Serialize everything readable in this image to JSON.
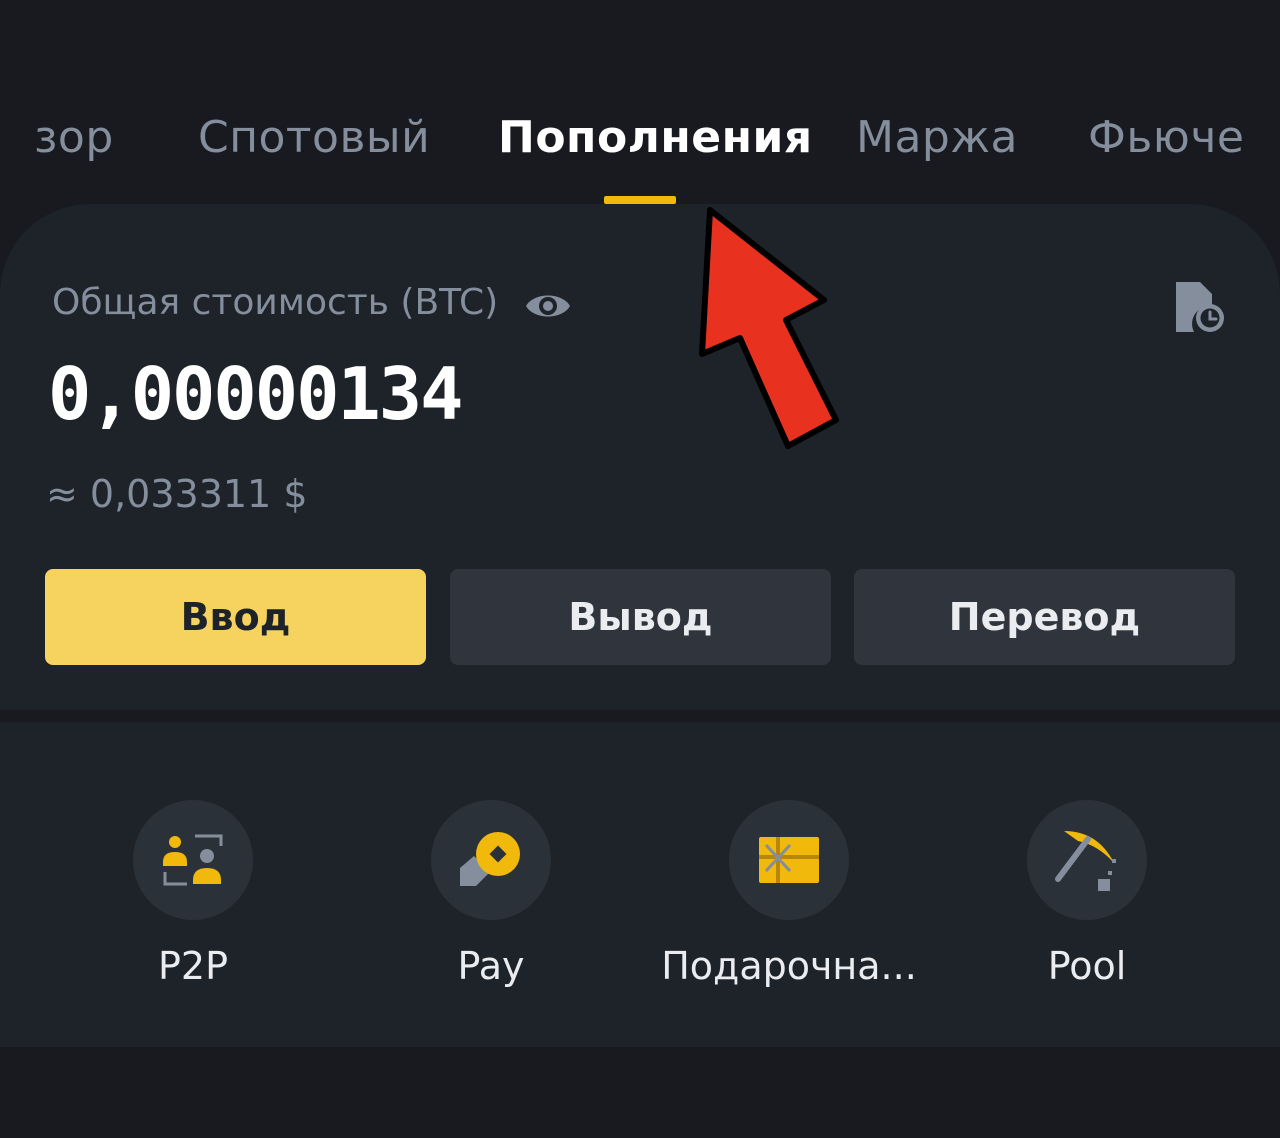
{
  "tabs": [
    {
      "label": "зор"
    },
    {
      "label": "Спотовый"
    },
    {
      "label": "Пополнения",
      "active": true
    },
    {
      "label": "Маржа"
    },
    {
      "label": "Фьюче"
    }
  ],
  "balance": {
    "label": "Общая стоимость (BTC)",
    "btc_value": "0,00000134",
    "usd_value": "≈ 0,033311 $"
  },
  "actions": {
    "deposit_label": "Ввод",
    "withdraw_label": "Вывод",
    "transfer_label": "Перевод"
  },
  "shortcuts": [
    {
      "label": "P2P",
      "icon": "p2p-icon"
    },
    {
      "label": "Pay",
      "icon": "pay-icon"
    },
    {
      "label": "Подарочна...",
      "icon": "gift-card-icon"
    },
    {
      "label": "Pool",
      "icon": "pool-pickaxe-icon"
    }
  ],
  "colors": {
    "accent": "#f0b90b",
    "deposit_button": "#f6d35e",
    "background": "#181a20",
    "card": "#1e2329",
    "annotation_arrow": "#e8321f"
  }
}
